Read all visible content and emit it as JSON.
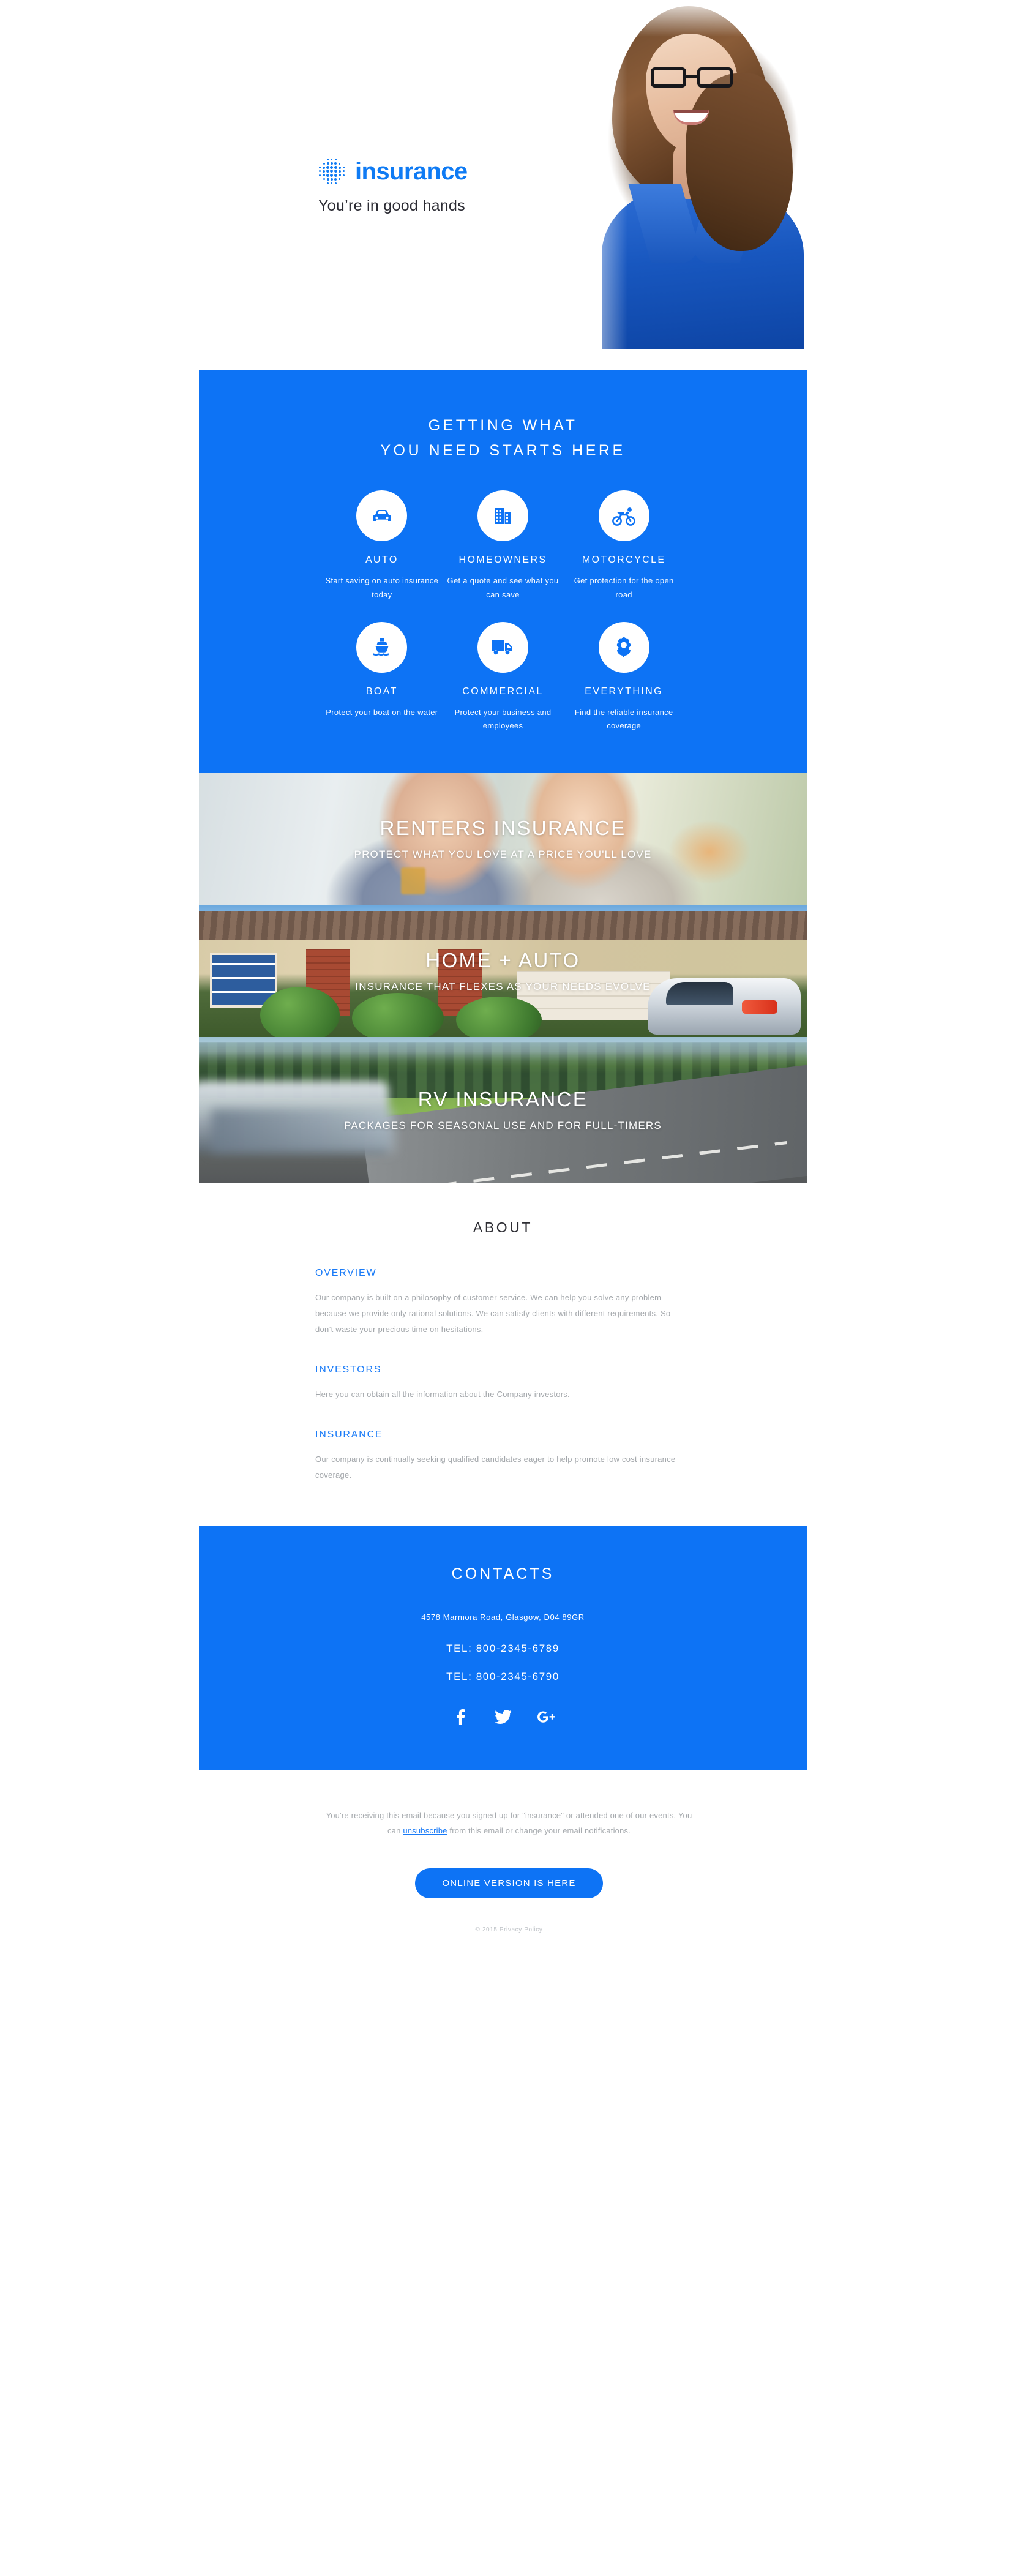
{
  "header": {
    "logo_icon": "dot-grid-icon",
    "brand_name": "insurance",
    "tagline": "You’re in good hands"
  },
  "services": {
    "title_line1": "GETTING WHAT",
    "title_line2": "YOU NEED STARTS HERE",
    "accent_bg": "#0d73f5",
    "items": [
      {
        "icon": "car-icon",
        "label": "AUTO",
        "desc": "Start saving on auto insurance today"
      },
      {
        "icon": "building-icon",
        "label": "HOMEOWNERS",
        "desc": "Get a quote and see what you can save"
      },
      {
        "icon": "motorcycle-icon",
        "label": "MOTORCYCLE",
        "desc": "Get protection for the open road"
      },
      {
        "icon": "boat-icon",
        "label": "BOAT",
        "desc": "Protect your boat on the water"
      },
      {
        "icon": "truck-icon",
        "label": "COMMERCIAL",
        "desc": "Protect your business and employees"
      },
      {
        "icon": "flower-icon",
        "label": "EVERYTHING",
        "desc": "Find the reliable insurance coverage"
      }
    ]
  },
  "banners": [
    {
      "title": "RENTERS INSURANCE",
      "subtitle": "PROTECT WHAT YOU LOVE AT A PRICE YOU'LL LOVE"
    },
    {
      "title": "HOME + AUTO",
      "subtitle": "INSURANCE THAT FLEXES AS YOUR NEEDS EVOLVE"
    },
    {
      "title": "RV INSURANCE",
      "subtitle": "PACKAGES FOR SEASONAL USE AND FOR FULL-TIMERS"
    }
  ],
  "about": {
    "title": "ABOUT",
    "accent_color": "#1a7bf7",
    "sections": [
      {
        "heading": "OVERVIEW",
        "body": "Our company is built on a philosophy of customer service. We can help you solve any problem because we provide only rational solutions. We can satisfy clients with different requirements. So don’t waste your precious time on hesitations."
      },
      {
        "heading": "INVESTORS",
        "body": "Here you can obtain all the information about the Company investors."
      },
      {
        "heading": "INSURANCE",
        "body": "Our company is continually seeking qualified candidates eager to help promote low cost insurance coverage."
      }
    ]
  },
  "contacts": {
    "title": "CONTACTS",
    "address": "4578 Marmora Road, Glasgow, D04 89GR",
    "tel1": "TEL: 800-2345-6789",
    "tel2": "TEL: 800-2345-6790",
    "socials": [
      {
        "icon": "facebook-icon",
        "label": "f"
      },
      {
        "icon": "twitter-icon",
        "label": "t"
      },
      {
        "icon": "google-plus-icon",
        "label": "g+"
      }
    ]
  },
  "footer": {
    "note_part1": "You're receiving this email because you signed up for \"insurance\" or attended one of our events. You can ",
    "unsubscribe_label": "unsubscribe",
    "note_part2": " from this email or change your email notifications.",
    "cta_label": "ONLINE VERSION IS HERE",
    "copyright": "© 2015 Privacy Policy"
  }
}
